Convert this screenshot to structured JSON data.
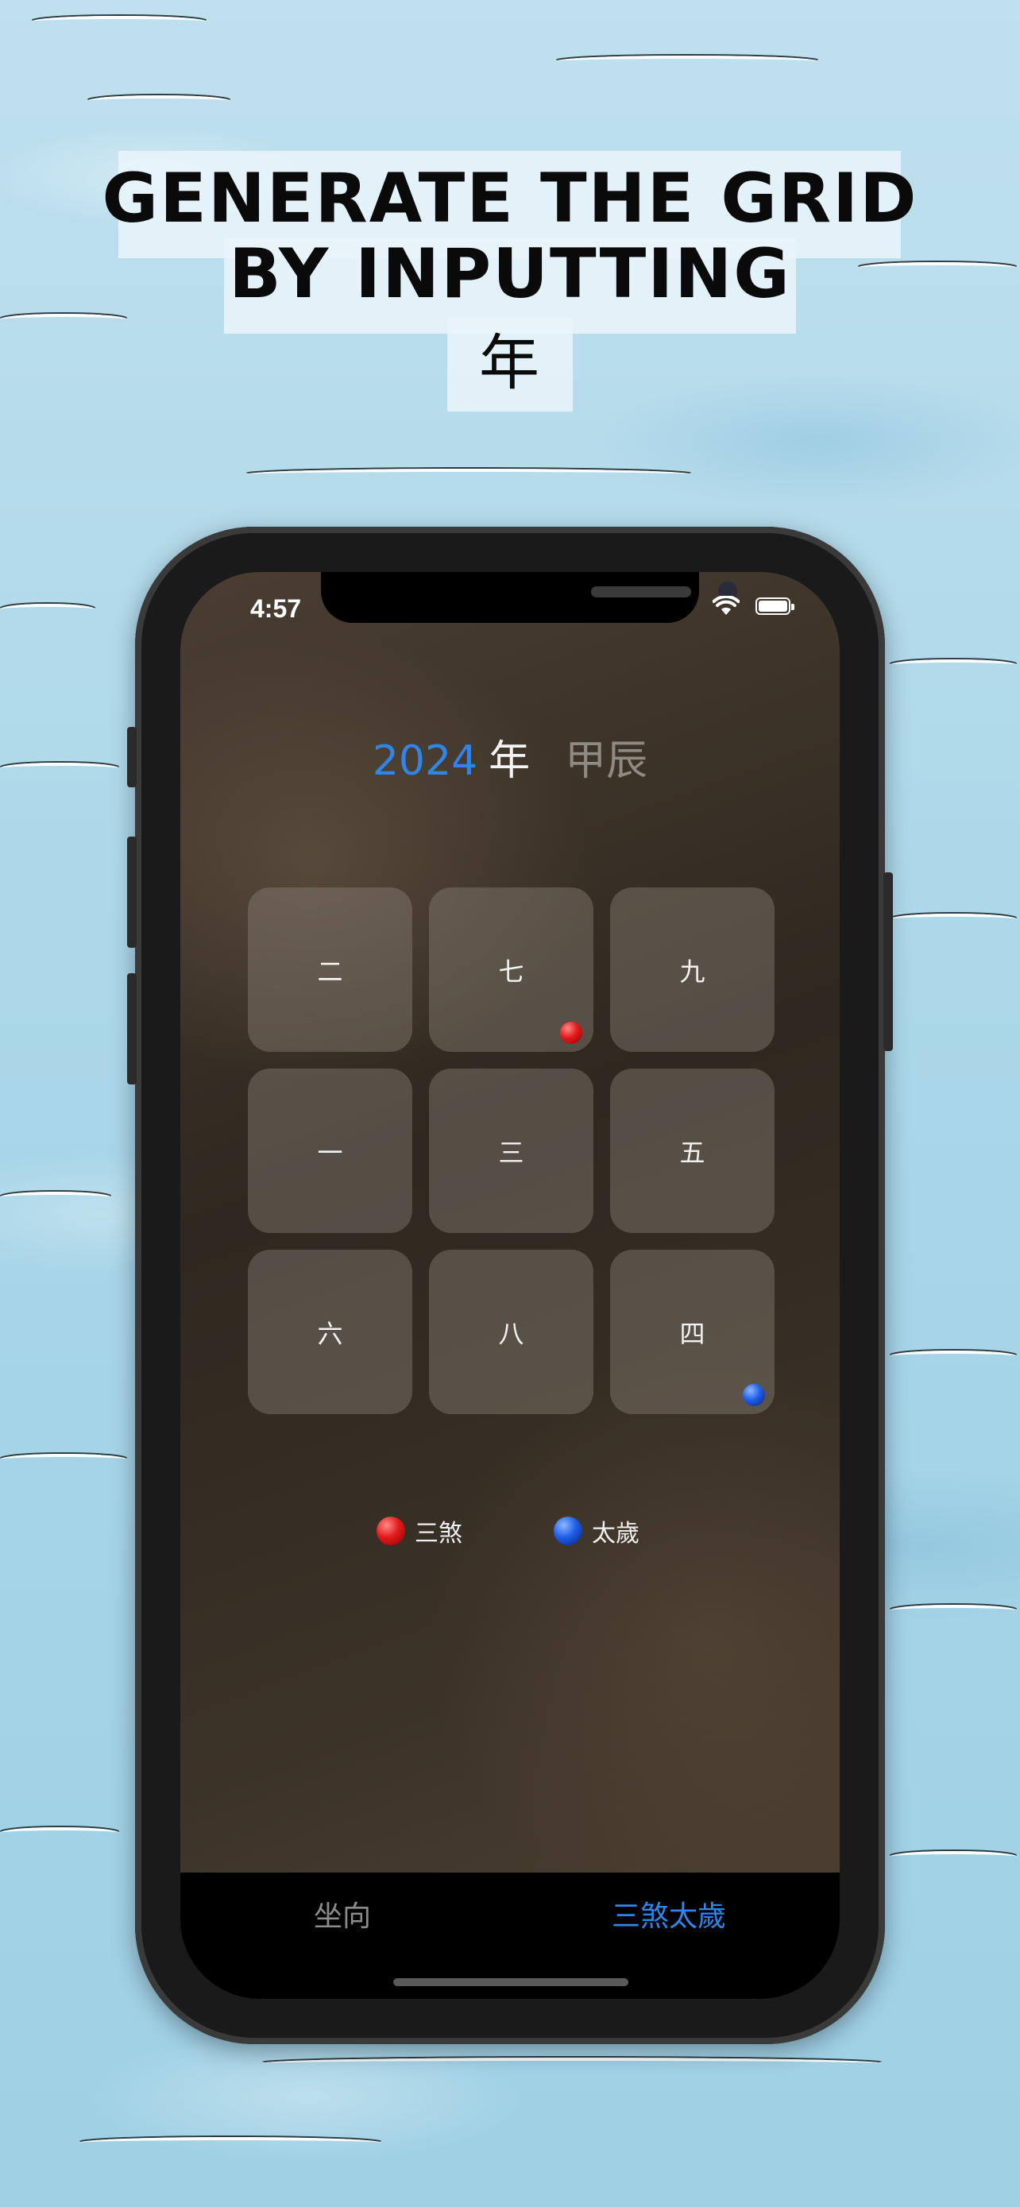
{
  "headline": {
    "line1": "GENERATE THE GRID",
    "line2": "BY INPUTTING",
    "line3": "年"
  },
  "status_bar": {
    "time": "4:57",
    "wifi_icon": "wifi-icon",
    "battery_icon": "battery-icon"
  },
  "year_row": {
    "year": "2024",
    "suffix": "年",
    "ganzhi": "甲辰"
  },
  "grid": {
    "cells": [
      "二",
      "七",
      "九",
      "一",
      "三",
      "五",
      "六",
      "八",
      "四"
    ],
    "markers": {
      "sansha_cell": "七",
      "taisui_cell": "四"
    }
  },
  "legend": {
    "sansha_label": "三煞",
    "taisui_label": "太歲",
    "sansha_color": "#e21b1b",
    "taisui_color": "#1f5ee8"
  },
  "tabbar": {
    "tab_left": "坐向",
    "tab_right": "三煞太歲",
    "active_color": "#2f86e8",
    "inactive_color": "#8c8c8c"
  }
}
